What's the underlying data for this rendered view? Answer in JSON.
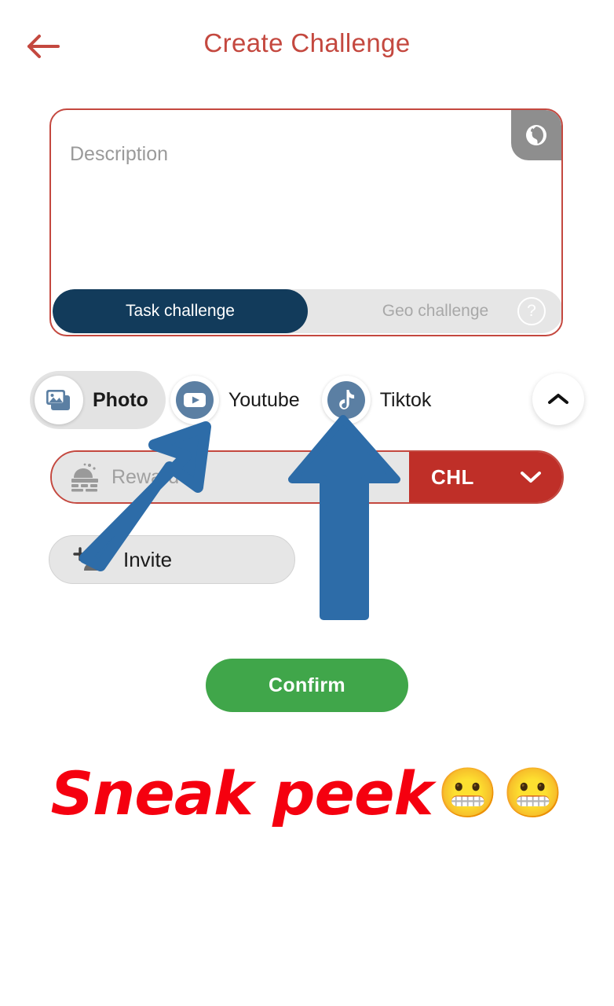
{
  "header": {
    "back_icon": "back-arrow-icon",
    "title": "Create Challenge",
    "title_color": "#C4483F"
  },
  "description": {
    "placeholder": "Description",
    "value": "",
    "globe_icon": "globe-icon",
    "border_color": "#C4483F"
  },
  "challenge_type_toggle": {
    "options": [
      {
        "label": "Task challenge",
        "selected": true
      },
      {
        "label": "Geo challenge",
        "selected": false
      }
    ],
    "help_icon_label": "?",
    "active_color": "#123B5B",
    "inactive_bg": "#E6E6E6"
  },
  "media_sources": {
    "options": [
      {
        "label": "Photo",
        "icon": "photo-icon",
        "selected": true
      },
      {
        "label": "Youtube",
        "icon": "youtube-icon",
        "selected": false
      },
      {
        "label": "Tiktok",
        "icon": "tiktok-icon",
        "selected": false
      }
    ],
    "collapse_icon": "chevron-up-icon",
    "icon_color": "#5B7FA3"
  },
  "reward": {
    "icon": "reward-gift-icon",
    "placeholder": "Reward",
    "value": "",
    "currency": "CHL",
    "currency_chevron": "chevron-down-icon",
    "currency_color": "#BF2F28"
  },
  "invite": {
    "icon": "add-person-icon",
    "label": "Invite"
  },
  "confirm": {
    "label": "Confirm",
    "color": "#40A64A"
  },
  "caption": {
    "text": "Sneak peek",
    "color": "#F5000F",
    "emoji_1": "😬",
    "emoji_2": "😬"
  },
  "annotations": {
    "arrow_1": {
      "name": "annotation-arrow-youtube",
      "color": "#2D6CA8"
    },
    "arrow_2": {
      "name": "annotation-arrow-tiktok",
      "color": "#2D6CA8"
    }
  }
}
